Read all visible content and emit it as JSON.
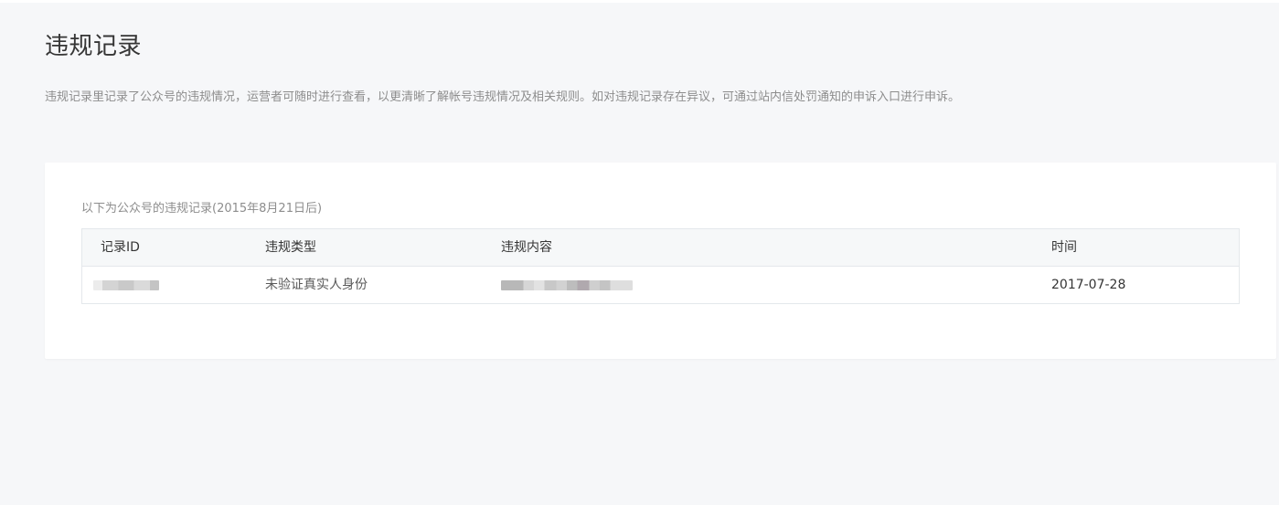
{
  "page": {
    "title": "违规记录",
    "description": "违规记录里记录了公众号的违规情况，运营者可随时进行查看，以更清晰了解帐号违规情况及相关规则。如对违规记录存在异议，可通过站内信处罚通知的申诉入口进行申诉。"
  },
  "records": {
    "caption": "以下为公众号的违规记录(2015年8月21日后)",
    "columns": {
      "id": "记录ID",
      "type": "违规类型",
      "content": "违规内容",
      "time": "时间"
    },
    "rows": [
      {
        "id": "",
        "type": "未验证真实人身份",
        "content": "",
        "time": "2017-07-28"
      }
    ]
  }
}
